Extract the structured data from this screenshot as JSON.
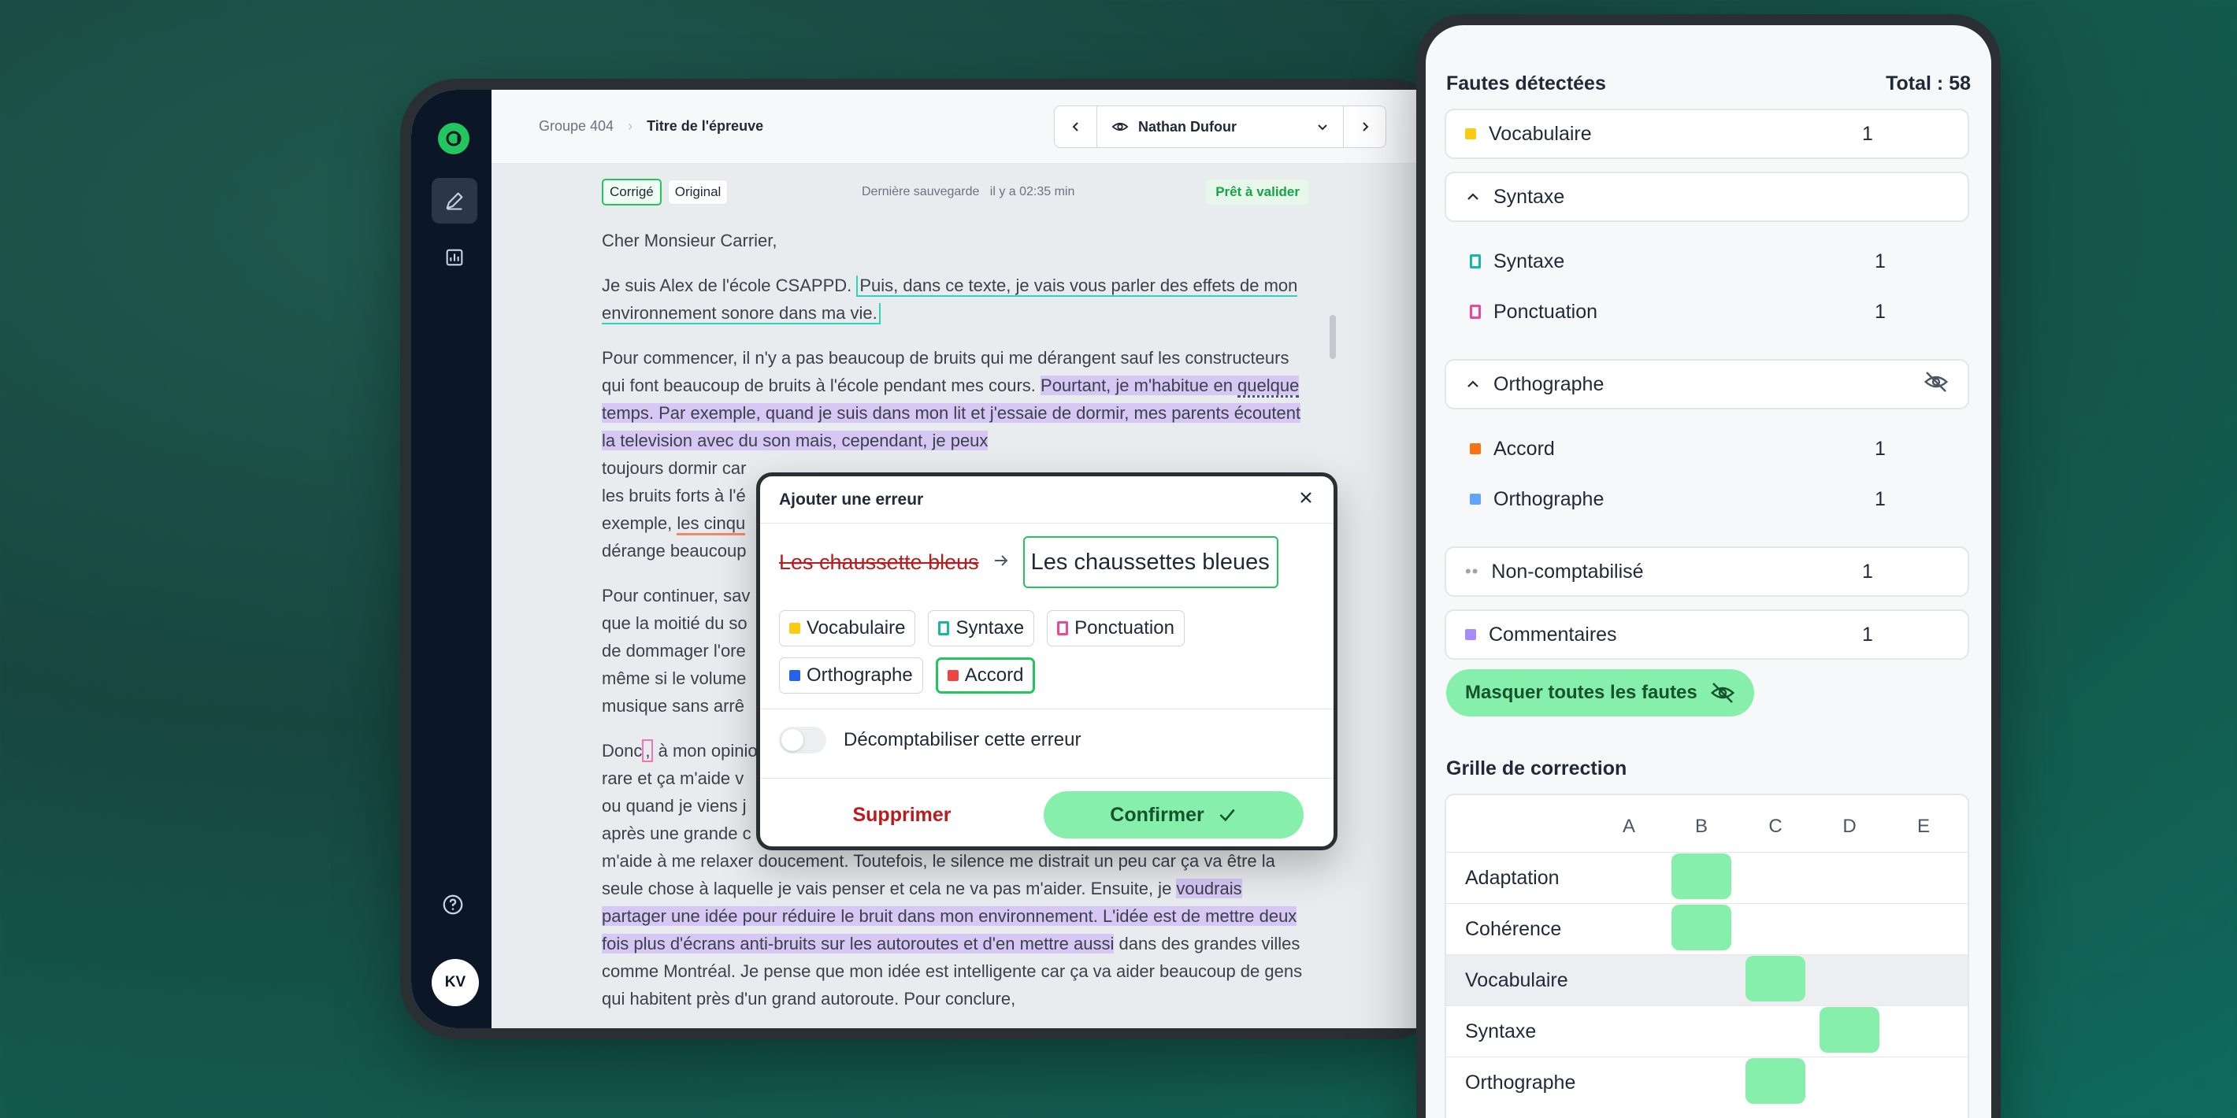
{
  "breadcrumb": {
    "group": "Groupe 404",
    "title": "Titre de l'épreuve"
  },
  "student": {
    "name": "Nathan Dufour"
  },
  "toolbar": {
    "tab_corrected": "Corrigé",
    "tab_original": "Original",
    "last_save_label": "Dernière sauvegarde",
    "last_save_time": "il y a 02:35 min",
    "ready": "Prêt à valider"
  },
  "document": {
    "greeting": "Cher Monsieur Carrier,",
    "p1_a": "Je suis Alex de l'école CSAPPD. ",
    "p1_b": "Puis, dans ce texte, je vais vous parler des effets de mon environnement sonore dans ma vie.",
    "p2_a": "Pour commencer, il n'y a pas beaucoup de bruits qui me dérangent sauf les constructeurs qui font beaucoup de bruits à l'école pendant mes cours. ",
    "p2_b": "Pourtant, je m'habitue en ",
    "p2_c": "quelque",
    "p2_d": " temps. Par exemple, quand je suis dans mon lit et j'essaie de dormir, mes parents écoutent la television avec du son mais, cependant, je peux",
    "p2_e": "toujours dormir car",
    "p2_f": "les bruits forts à l'é",
    "p2_g": "exemple, ",
    "p2_h": "les cinqu",
    "p2_i": "dérange beaucoup",
    "p3_a": "Pour continuer, sav",
    "p3_b": "que la moitié du so",
    "p3_c": "de dommager l'ore",
    "p3_d": "même si le volume",
    "p3_e": "musique sans arrê",
    "p4_a": "Donc",
    "p4_b": ",",
    "p4_c": " à mon opinio",
    "p4_d": "rare et ça m'aide v",
    "p4_e": "ou quand je viens j",
    "p4_f": "après une grande c",
    "p4_g": "m'aide à me relaxer doucement. Toutefois, le silence me distrait un peu car ça va être la seule chose à laquelle je vais penser et cela ne va pas m'aider. Ensuite, je ",
    "p4_h": "voudrais partager une idée pour réduire le bruit dans mon environnement. L'idée est de mettre deux fois plus d'écrans anti-bruits sur les autoroutes et d'en mettre aussi",
    "p4_i": " dans des grandes villes comme Montréal. Je pense que mon idée est intelligente car ça va aider beaucoup de gens qui habitent près d'un grand autoroute. Pour conclure,"
  },
  "modal": {
    "title": "Ajouter une erreur",
    "original": "Les chaussette bleus",
    "correction": "Les chaussettes bleues",
    "chips": [
      {
        "label": "Vocabulaire",
        "color": "#facc15"
      },
      {
        "label": "Syntaxe",
        "color": "#14b8a6"
      },
      {
        "label": "Ponctuation",
        "color": "#ec4899"
      },
      {
        "label": "Orthographe",
        "color": "#2563eb"
      },
      {
        "label": "Accord",
        "color": "#ef4444"
      }
    ],
    "selected_chip": "Accord",
    "toggle_label": "Décomptabiliser cette erreur",
    "toggle_on": false,
    "delete": "Supprimer",
    "confirm": "Confirmer"
  },
  "panel": {
    "title": "Fautes détectées",
    "total": "Total : 58",
    "categories": {
      "vocabulaire": {
        "label": "Vocabulaire",
        "count": "1",
        "color": "#facc15"
      },
      "syntaxe_group": {
        "label": "Syntaxe"
      },
      "syntaxe": {
        "label": "Syntaxe",
        "count": "1",
        "color": "#14b8a6"
      },
      "ponctuation": {
        "label": "Ponctuation",
        "count": "1",
        "color": "#ec4899"
      },
      "orthographe_group": {
        "label": "Orthographe"
      },
      "accord": {
        "label": "Accord",
        "count": "1",
        "color": "#f97316"
      },
      "orthographe": {
        "label": "Orthographe",
        "count": "1",
        "color": "#60a5fa"
      },
      "non_comptabilise": {
        "label": "Non-comptabilisé",
        "count": "1"
      },
      "commentaires": {
        "label": "Commentaires",
        "count": "1",
        "color": "#a78bfa"
      }
    },
    "hide_all": "Masquer toutes les fautes"
  },
  "grid": {
    "title": "Grille de correction",
    "columns": [
      "A",
      "B",
      "C",
      "D",
      "E"
    ],
    "rows": [
      {
        "name": "Adaptation",
        "grade": "B"
      },
      {
        "name": "Cohérence",
        "grade": "B"
      },
      {
        "name": "Vocabulaire",
        "grade": "C"
      },
      {
        "name": "Syntaxe",
        "grade": "D"
      },
      {
        "name": "Orthographe",
        "grade": "C"
      }
    ]
  },
  "user": {
    "initials": "KV"
  }
}
